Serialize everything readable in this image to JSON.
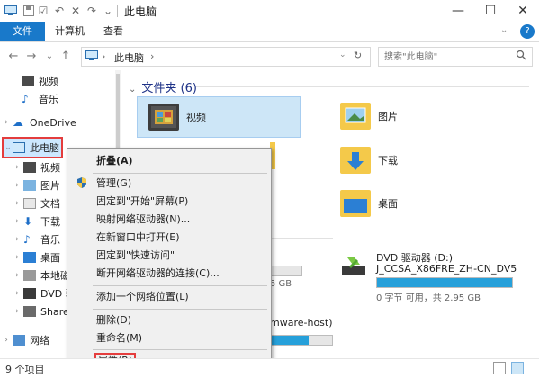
{
  "window": {
    "title": "此电脑",
    "controls": {
      "minimize": "—",
      "maximize": "☐",
      "close": "✕"
    }
  },
  "quick_access_icons": [
    "save-icon",
    "checkbox-icon",
    "undo-icon",
    "delete-icon",
    "redo-icon",
    "pin-icon"
  ],
  "ribbon": {
    "tabs": [
      {
        "label": "文件",
        "active": true
      },
      {
        "label": "计算机",
        "active": false
      },
      {
        "label": "查看",
        "active": false
      }
    ],
    "help": "?"
  },
  "navigation": {
    "back": "←",
    "forward": "→",
    "recent": "⌄",
    "up": "↑"
  },
  "address_bar": {
    "path_segments": [
      "此电脑"
    ],
    "separator": "›"
  },
  "search": {
    "placeholder": "搜索\"此电脑\""
  },
  "nav_pane": {
    "items": [
      {
        "label": "视频",
        "icon": "video-icon"
      },
      {
        "label": "音乐",
        "icon": "music-icon"
      },
      {
        "label": "OneDrive",
        "icon": "cloud-icon"
      },
      {
        "label": "此电脑",
        "icon": "computer-icon",
        "selected": true
      },
      {
        "label": "视频",
        "icon": "video-icon"
      },
      {
        "label": "图片",
        "icon": "pictures-icon"
      },
      {
        "label": "文档",
        "icon": "document-icon"
      },
      {
        "label": "下载",
        "icon": "download-icon"
      },
      {
        "label": "音乐",
        "icon": "music-icon"
      },
      {
        "label": "桌面",
        "icon": "desktop-icon"
      },
      {
        "label": "本地磁",
        "icon": "drive-icon"
      },
      {
        "label": "DVD 驱",
        "icon": "dvd-icon"
      },
      {
        "label": "Shared",
        "icon": "network-drive-icon"
      },
      {
        "label": "网络",
        "icon": "network-icon"
      }
    ]
  },
  "content": {
    "folders_header": "文件夹 (6)",
    "folders": [
      {
        "label": "视频"
      },
      {
        "label": "图片"
      },
      {
        "label": "下载"
      },
      {
        "label": "桌面"
      }
    ],
    "drives": {
      "c_free": "5 GB",
      "dvd_title": "DVD 驱动器 (D:)",
      "dvd_volume": "J_CCSA_X86FRE_ZH-CN_DV5",
      "dvd_space": "0 字节 可用，共 2.95 GB",
      "dvd_fill": 1.0,
      "shared_label": "mware-host)",
      "shared_fill": 0.62
    }
  },
  "context_menu": {
    "items": [
      {
        "label": "折叠(A)",
        "bold": true
      },
      {
        "label": "管理(G)",
        "icon": "shield-icon"
      },
      {
        "label": "固定到\"开始\"屏幕(P)"
      },
      {
        "label": "映射网络驱动器(N)..."
      },
      {
        "label": "在新窗口中打开(E)"
      },
      {
        "label": "固定到\"快速访问\""
      },
      {
        "label": "断开网络驱动器的连接(C)..."
      },
      {
        "label": "添加一个网络位置(L)"
      },
      {
        "label": "删除(D)"
      },
      {
        "label": "重命名(M)"
      },
      {
        "label": "属性(R)",
        "highlighted": true
      }
    ]
  },
  "status_bar": {
    "count": "9 个项目"
  },
  "colors": {
    "accent": "#1979ca",
    "highlight_box": "#e43d3d",
    "selection": "#cde6f7",
    "folder_yellow": "#f4c94a"
  }
}
